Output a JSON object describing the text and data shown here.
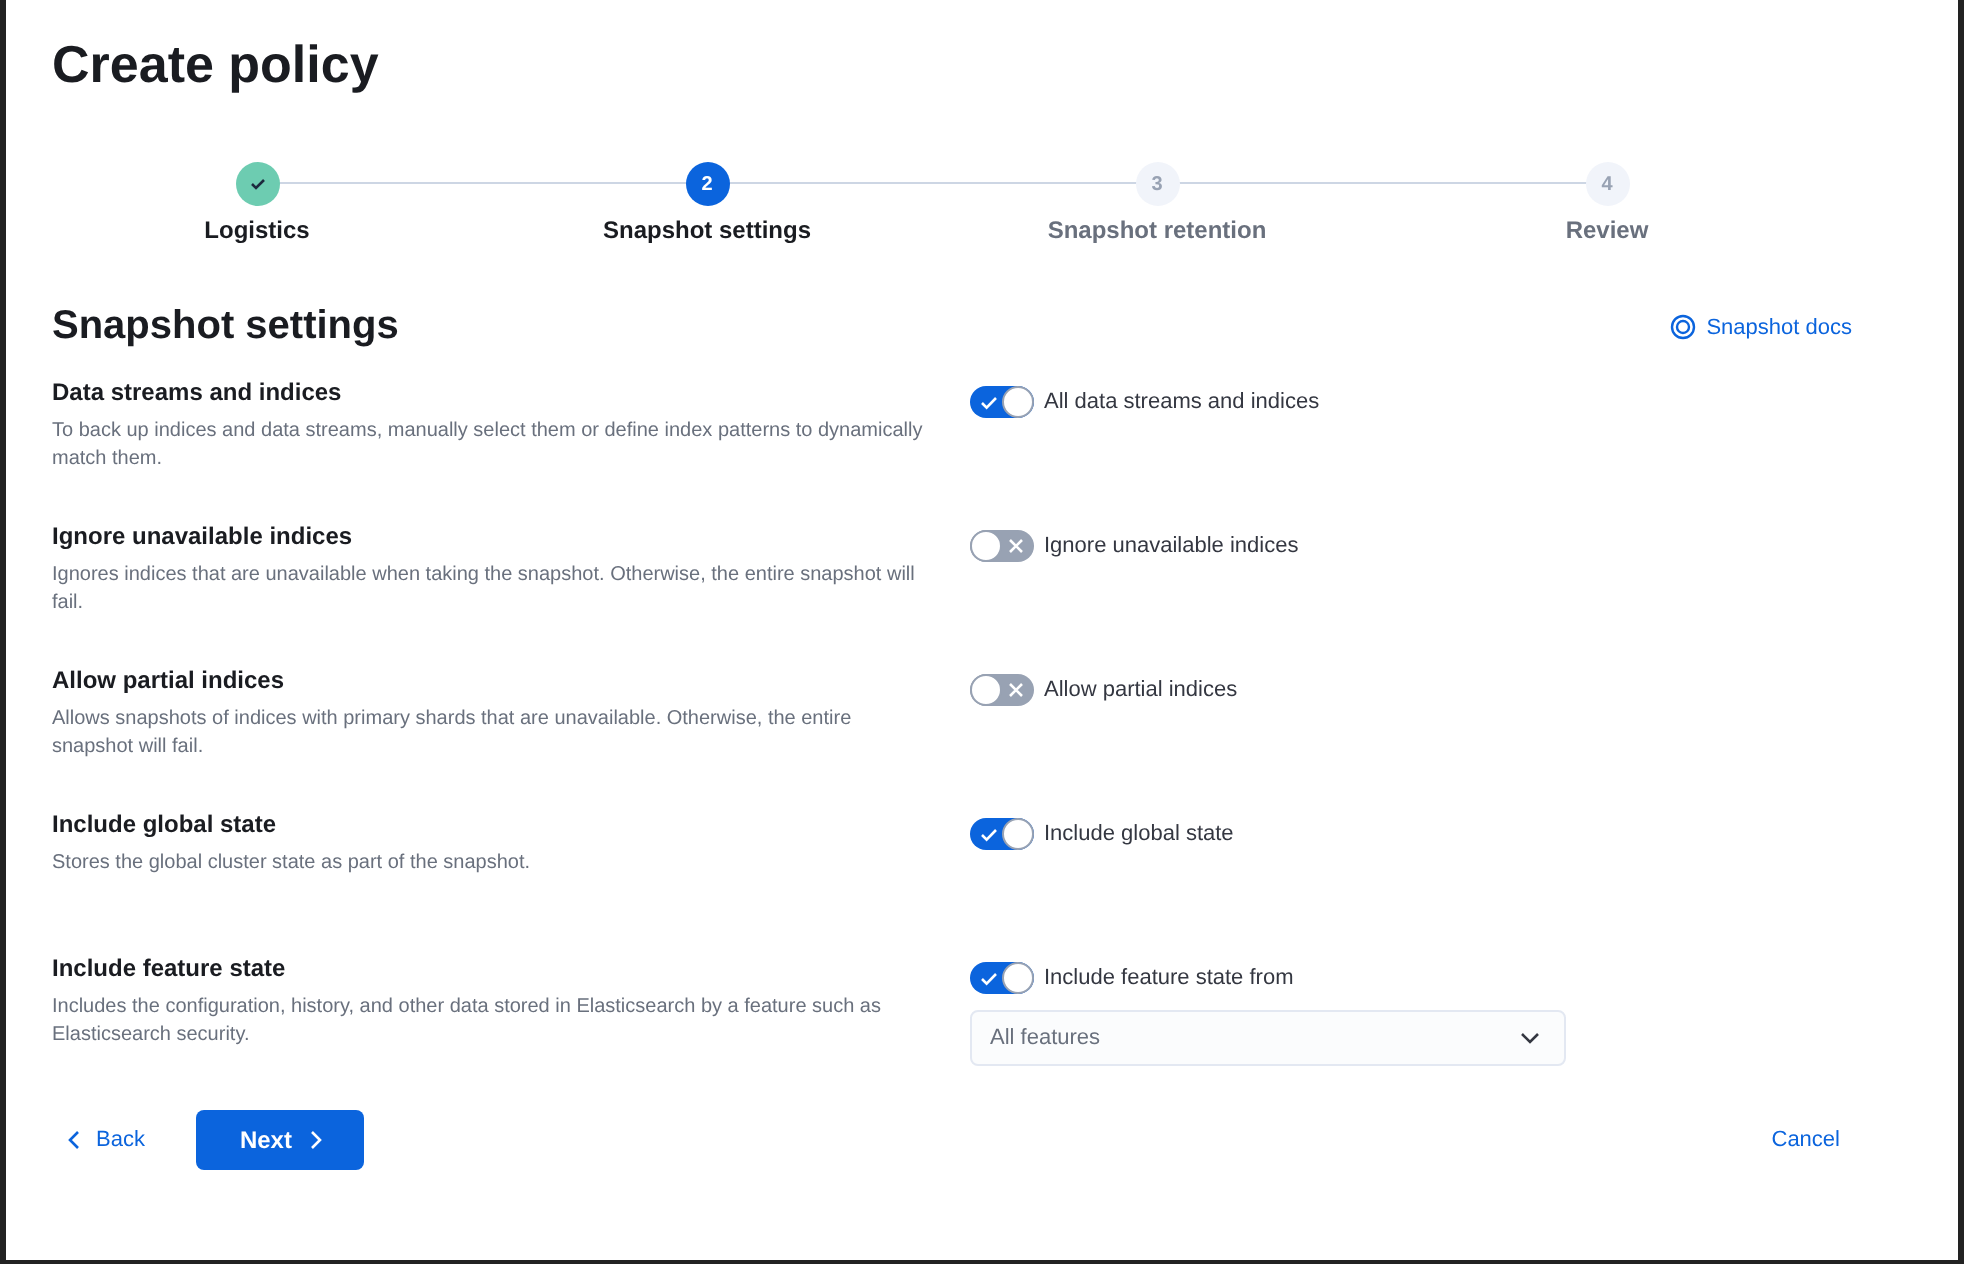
{
  "title": "Create policy",
  "steps": [
    {
      "label": "Logistics",
      "complete": true,
      "selected": false
    },
    {
      "number": "2",
      "label": "Snapshot settings",
      "complete": false,
      "selected": true
    },
    {
      "number": "3",
      "label": "Snapshot retention",
      "complete": false,
      "selected": false
    },
    {
      "number": "4",
      "label": "Review",
      "complete": false,
      "selected": false
    }
  ],
  "section": {
    "title": "Snapshot settings",
    "docs_link": "Snapshot docs"
  },
  "settings": [
    {
      "title": "Data streams and indices",
      "description": "To back up indices and data streams, manually select them or define index patterns to dynamically match them.",
      "toggle_label": "All data streams and indices",
      "on": true
    },
    {
      "title": "Ignore unavailable indices",
      "description": "Ignores indices that are unavailable when taking the snapshot. Otherwise, the entire snapshot will fail.",
      "toggle_label": "Ignore unavailable indices",
      "on": false
    },
    {
      "title": "Allow partial indices",
      "description": "Allows snapshots of indices with primary shards that are unavailable. Otherwise, the entire snapshot will fail.",
      "toggle_label": "Allow partial indices",
      "on": false
    },
    {
      "title": "Include global state",
      "description": "Stores the global cluster state as part of the snapshot.",
      "toggle_label": "Include global state",
      "on": true
    },
    {
      "title": "Include feature state",
      "description": "Includes the configuration, history, and other data stored in Elasticsearch by a feature such as Elasticsearch security.",
      "toggle_label": "Include feature state from",
      "on": true,
      "select": {
        "value": "All features"
      }
    }
  ],
  "footer": {
    "back": "Back",
    "next": "Next",
    "cancel": "Cancel"
  }
}
